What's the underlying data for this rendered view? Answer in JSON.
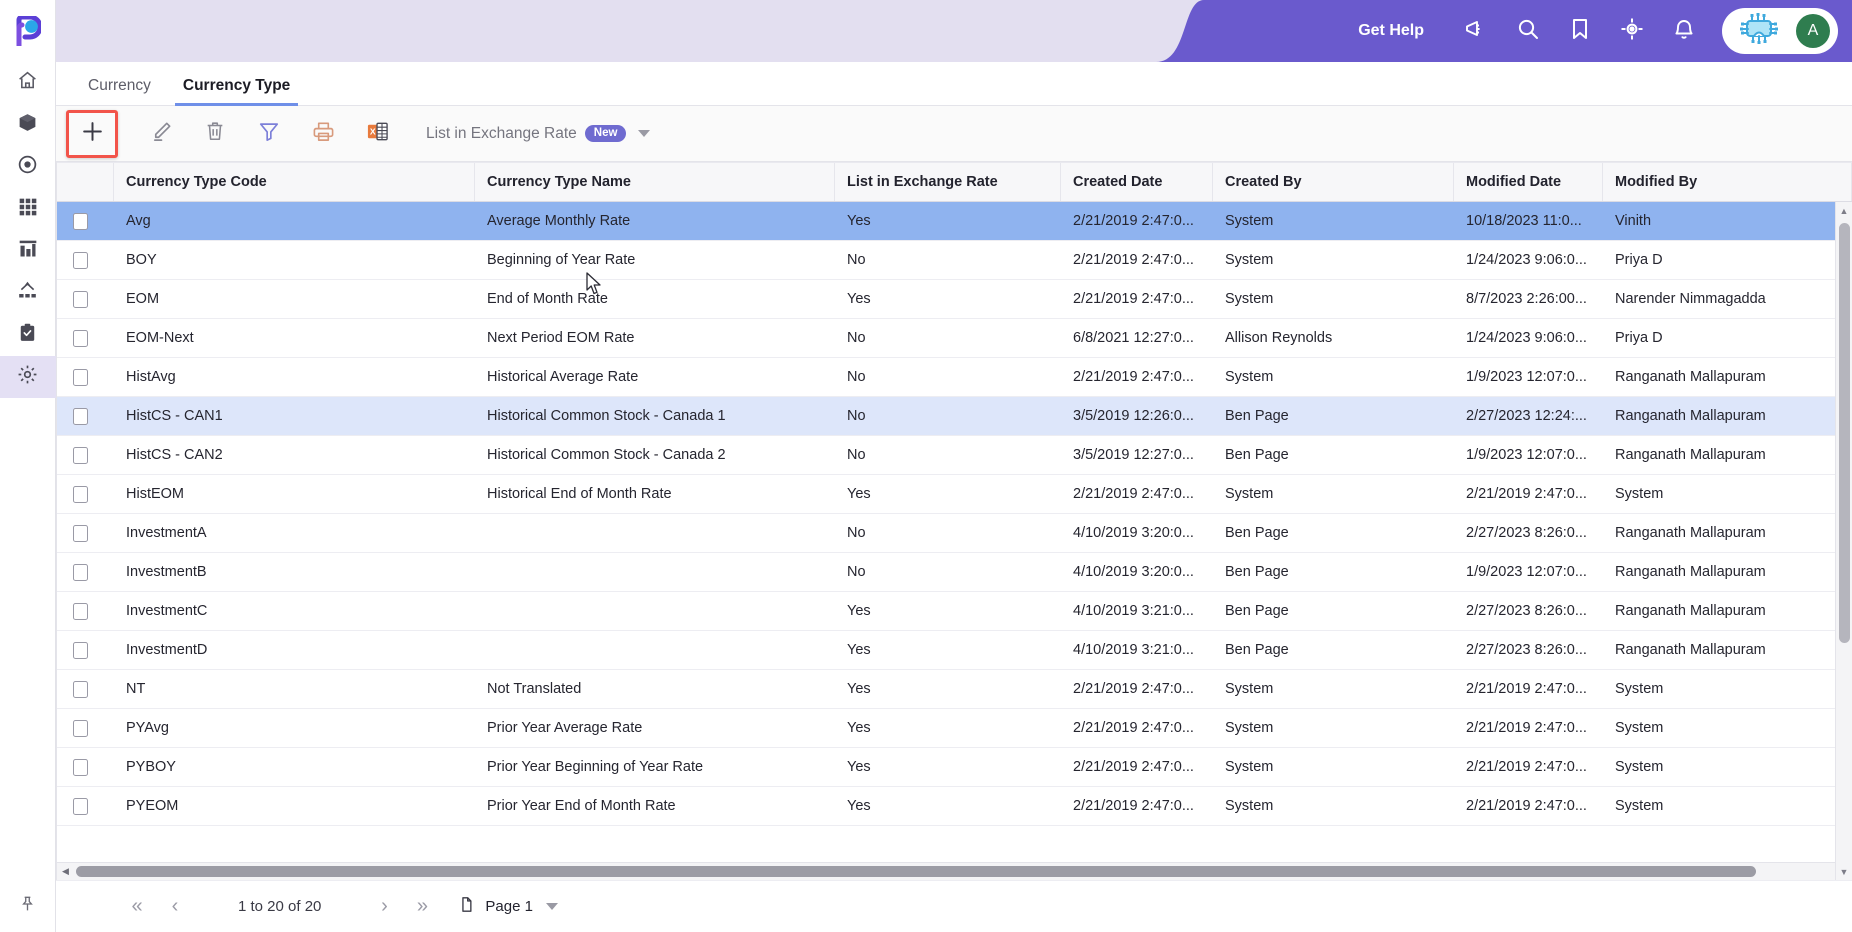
{
  "app": {
    "logo_name": "planful-logo"
  },
  "sidebar": {
    "items": [
      {
        "name": "home",
        "icon": "home-icon",
        "active": false
      },
      {
        "name": "models",
        "icon": "cube-icon",
        "active": false
      },
      {
        "name": "target",
        "icon": "target-icon",
        "active": false
      },
      {
        "name": "apps",
        "icon": "grid-icon",
        "active": false
      },
      {
        "name": "reports",
        "icon": "bar-chart-icon",
        "active": false
      },
      {
        "name": "hierarchy",
        "icon": "hierarchy-icon",
        "active": false
      },
      {
        "name": "tasks",
        "icon": "clipboard-icon",
        "active": false
      },
      {
        "name": "settings",
        "icon": "gear-icon",
        "active": true
      }
    ],
    "pin": {
      "name": "pin",
      "icon": "pin-icon"
    }
  },
  "header": {
    "get_help": "Get Help",
    "icons": [
      {
        "name": "announcements",
        "icon": "megaphone-icon"
      },
      {
        "name": "search",
        "icon": "search-icon"
      },
      {
        "name": "bookmarks",
        "icon": "bookmark-icon"
      },
      {
        "name": "navigate",
        "icon": "target-crosshair-icon"
      },
      {
        "name": "notifications",
        "icon": "bell-icon"
      }
    ],
    "assistant_icon": "ai-chip-icon",
    "avatar_initial": "A",
    "colors": {
      "purple": "#6a5acd",
      "lavender": "#e3dff0",
      "avatar_green": "#2f7d4f",
      "assistant_cyan": "#5ec8ee"
    }
  },
  "tabs": [
    {
      "label": "Currency",
      "active": false
    },
    {
      "label": "Currency Type",
      "active": true
    }
  ],
  "toolbar": {
    "buttons": [
      {
        "name": "add",
        "icon": "plus-icon",
        "highlighted": true
      },
      {
        "name": "edit",
        "icon": "pencil-icon",
        "highlighted": false
      },
      {
        "name": "delete",
        "icon": "trash-icon",
        "highlighted": false
      },
      {
        "name": "filter",
        "icon": "funnel-icon",
        "highlighted": false
      },
      {
        "name": "print",
        "icon": "printer-icon",
        "highlighted": false
      },
      {
        "name": "export",
        "icon": "excel-icon",
        "highlighted": false
      }
    ],
    "dropdown": {
      "label": "List in Exchange Rate",
      "badge": "New",
      "badge_color": "#6f6bd0"
    }
  },
  "grid": {
    "columns": [
      "Currency Type Code",
      "Currency Type Name",
      "List in Exchange Rate",
      "Created Date",
      "Created By",
      "Modified Date",
      "Modified By"
    ],
    "value_colors": {
      "yes": "#17807c",
      "no": "#a3212b"
    },
    "selected_row_color": "#8fb3ef",
    "hovered_row_color": "#dde6fa",
    "rows": [
      {
        "code": "Avg",
        "name": "Average Monthly Rate",
        "list": "Yes",
        "created_date": "2/21/2019 2:47:0...",
        "created_by": "System",
        "modified_date": "10/18/2023 11:0...",
        "modified_by": "Vinith",
        "state": "selected"
      },
      {
        "code": "BOY",
        "name": "Beginning of Year Rate",
        "list": "No",
        "created_date": "2/21/2019 2:47:0...",
        "created_by": "System",
        "modified_date": "1/24/2023 9:06:0...",
        "modified_by": "Priya D",
        "state": ""
      },
      {
        "code": "EOM",
        "name": "End of Month Rate",
        "list": "Yes",
        "created_date": "2/21/2019 2:47:0...",
        "created_by": "System",
        "modified_date": "8/7/2023 2:26:00...",
        "modified_by": "Narender Nimmagadda",
        "state": ""
      },
      {
        "code": "EOM-Next",
        "name": "Next Period EOM Rate",
        "list": "No",
        "created_date": "6/8/2021 12:27:0...",
        "created_by": "Allison Reynolds",
        "modified_date": "1/24/2023 9:06:0...",
        "modified_by": "Priya D",
        "state": ""
      },
      {
        "code": "HistAvg",
        "name": "Historical Average Rate",
        "list": "No",
        "created_date": "2/21/2019 2:47:0...",
        "created_by": "System",
        "modified_date": "1/9/2023 12:07:0...",
        "modified_by": "Ranganath Mallapuram",
        "state": ""
      },
      {
        "code": "HistCS - CAN1",
        "name": "Historical Common Stock - Canada 1",
        "list": "No",
        "created_date": "3/5/2019 12:26:0...",
        "created_by": "Ben Page",
        "modified_date": "2/27/2023 12:24:...",
        "modified_by": "Ranganath Mallapuram",
        "state": "hovered"
      },
      {
        "code": "HistCS - CAN2",
        "name": "Historical Common Stock - Canada 2",
        "list": "No",
        "created_date": "3/5/2019 12:27:0...",
        "created_by": "Ben Page",
        "modified_date": "1/9/2023 12:07:0...",
        "modified_by": "Ranganath Mallapuram",
        "state": ""
      },
      {
        "code": "HistEOM",
        "name": "Historical End of Month Rate",
        "list": "Yes",
        "created_date": "2/21/2019 2:47:0...",
        "created_by": "System",
        "modified_date": "2/21/2019 2:47:0...",
        "modified_by": "System",
        "state": ""
      },
      {
        "code": "InvestmentA",
        "name": "",
        "list": "No",
        "created_date": "4/10/2019 3:20:0...",
        "created_by": "Ben Page",
        "modified_date": "2/27/2023 8:26:0...",
        "modified_by": "Ranganath Mallapuram",
        "state": ""
      },
      {
        "code": "InvestmentB",
        "name": "",
        "list": "No",
        "created_date": "4/10/2019 3:20:0...",
        "created_by": "Ben Page",
        "modified_date": "1/9/2023 12:07:0...",
        "modified_by": "Ranganath Mallapuram",
        "state": ""
      },
      {
        "code": "InvestmentC",
        "name": "",
        "list": "Yes",
        "created_date": "4/10/2019 3:21:0...",
        "created_by": "Ben Page",
        "modified_date": "2/27/2023 8:26:0...",
        "modified_by": "Ranganath Mallapuram",
        "state": ""
      },
      {
        "code": "InvestmentD",
        "name": "",
        "list": "Yes",
        "created_date": "4/10/2019 3:21:0...",
        "created_by": "Ben Page",
        "modified_date": "2/27/2023 8:26:0...",
        "modified_by": "Ranganath Mallapuram",
        "state": ""
      },
      {
        "code": "NT",
        "name": "Not Translated",
        "list": "Yes",
        "created_date": "2/21/2019 2:47:0...",
        "created_by": "System",
        "modified_date": "2/21/2019 2:47:0...",
        "modified_by": "System",
        "state": ""
      },
      {
        "code": "PYAvg",
        "name": "Prior Year Average Rate",
        "list": "Yes",
        "created_date": "2/21/2019 2:47:0...",
        "created_by": "System",
        "modified_date": "2/21/2019 2:47:0...",
        "modified_by": "System",
        "state": ""
      },
      {
        "code": "PYBOY",
        "name": "Prior Year Beginning of Year Rate",
        "list": "Yes",
        "created_date": "2/21/2019 2:47:0...",
        "created_by": "System",
        "modified_date": "2/21/2019 2:47:0...",
        "modified_by": "System",
        "state": ""
      },
      {
        "code": "PYEOM",
        "name": "Prior Year End of Month Rate",
        "list": "Yes",
        "created_date": "2/21/2019 2:47:0...",
        "created_by": "System",
        "modified_date": "2/21/2019 2:47:0...",
        "modified_by": "System",
        "state": ""
      }
    ]
  },
  "pager": {
    "first_label": "«",
    "prev_label": "‹",
    "count_label": "1 to 20 of 20",
    "next_label": "›",
    "last_label": "»",
    "page_label": "Page 1",
    "page_icon": "pages-icon"
  }
}
